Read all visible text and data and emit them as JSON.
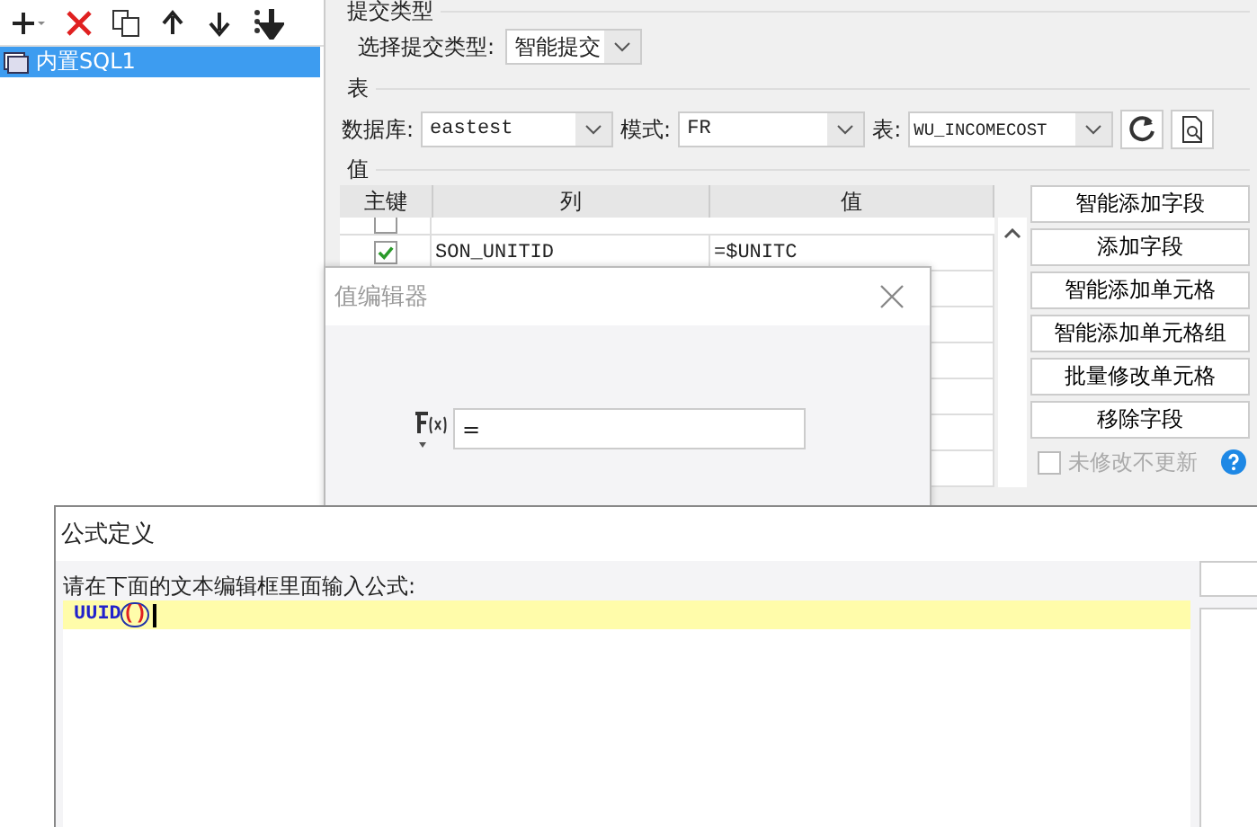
{
  "tree": [
    {
      "label": "内置SQL1",
      "selected": true
    }
  ],
  "submit_type": {
    "label": "提交类型",
    "field_label": "选择提交类型:",
    "value": "智能提交"
  },
  "table_section": {
    "label": "表",
    "database_label": "数据库:",
    "database": "eastest",
    "schema_label": "模式:",
    "schema": "FR",
    "table_label": "表:",
    "table": "WU_INCOMECOST"
  },
  "values_section": {
    "label": "值",
    "columns": [
      "主键",
      "列",
      "值"
    ],
    "rows": [
      {
        "key": false
      },
      {
        "key": true,
        "column": "SON_UNITID",
        "value": "=$UNITC"
      },
      {},
      {},
      {},
      {},
      {},
      {}
    ]
  },
  "buttons": [
    "智能添加字段",
    "添加字段",
    "智能添加单元格",
    "智能添加单元格组",
    "批量修改单元格",
    "移除字段"
  ],
  "unchanged_checkbox": {
    "label": "未修改不更新",
    "checked": false,
    "disabled": true
  },
  "value_editor": {
    "title": "值编辑器",
    "formula_value": "="
  },
  "formula_dialog": {
    "title": "公式定义",
    "prompt": "请在下面的文本编辑框里面输入公式:",
    "tokens": [
      {
        "text": "UUID",
        "kind": "function"
      },
      {
        "text": "()",
        "kind": "paren"
      }
    ]
  }
}
